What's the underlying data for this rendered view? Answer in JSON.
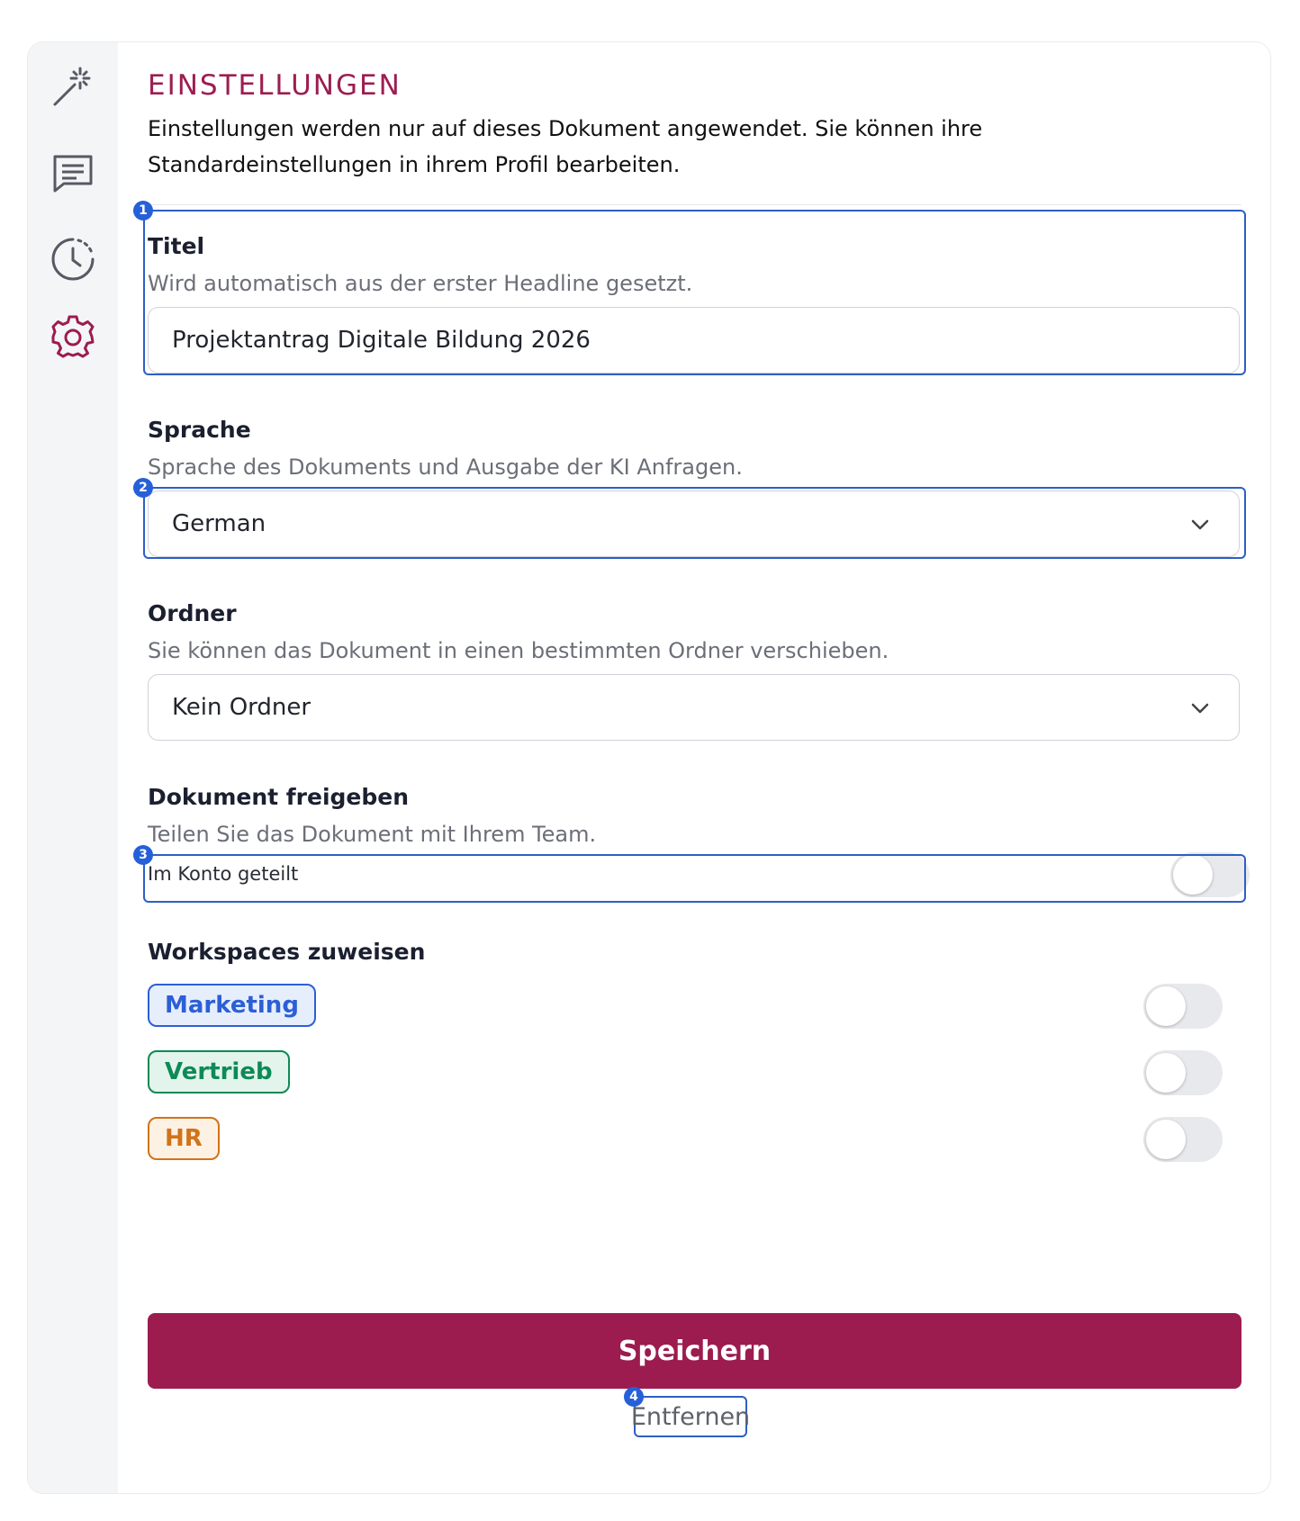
{
  "sidebar": {
    "items": [
      {
        "icon": "magic-wand-icon"
      },
      {
        "icon": "chat-icon"
      },
      {
        "icon": "history-icon"
      },
      {
        "icon": "gear-icon",
        "active": true
      }
    ]
  },
  "settings": {
    "heading": "EINSTELLUNGEN",
    "intro": "Einstellungen werden nur auf dieses Dokument angewendet. Sie können ihre Standardeinstellungen in ihrem Profil bearbeiten."
  },
  "title_field": {
    "label": "Titel",
    "description": "Wird automatisch aus der erster Headline gesetzt.",
    "value": "Projektantrag Digitale Bildung 2026"
  },
  "language_field": {
    "label": "Sprache",
    "description": "Sprache des Dokuments und Ausgabe der KI Anfragen.",
    "value": "German"
  },
  "folder_field": {
    "label": "Ordner",
    "description": "Sie können das Dokument in einen bestimmten Ordner verschieben.",
    "value": "Kein Ordner"
  },
  "share": {
    "label": "Dokument freigeben",
    "description": "Teilen Sie das Dokument mit Ihrem Team.",
    "toggle_label": "Im Konto geteilt",
    "enabled": false
  },
  "workspaces": {
    "label": "Workspaces zuweisen",
    "items": [
      {
        "name": "Marketing",
        "color": "#2c5fd6",
        "bg": "#e6eefc",
        "enabled": false
      },
      {
        "name": "Vertrieb",
        "color": "#0e8a54",
        "bg": "#e2f4ec",
        "enabled": false
      },
      {
        "name": "HR",
        "color": "#d1731a",
        "bg": "#fdf1e4",
        "enabled": false
      }
    ]
  },
  "actions": {
    "save_label": "Speichern",
    "remove_label": "Entfernen"
  },
  "annotations": [
    "1",
    "2",
    "3",
    "4"
  ],
  "colors": {
    "accent": "#9c1c4f",
    "annotation": "#2660d9"
  }
}
